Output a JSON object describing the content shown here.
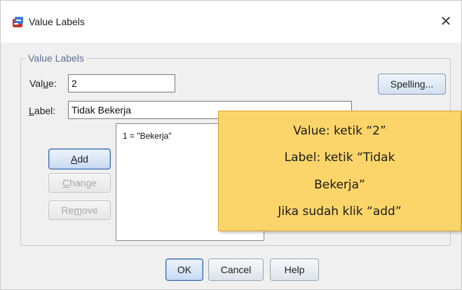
{
  "window": {
    "title": "Value Labels",
    "close_glyph": "✕"
  },
  "group": {
    "legend": "Value Labels"
  },
  "value_field": {
    "label_pre": "Val",
    "label_key": "u",
    "label_post": "e:",
    "value": "2"
  },
  "label_field": {
    "label_key": "L",
    "label_post": "abel:",
    "value": "Tidak Bekerja"
  },
  "buttons": {
    "spelling": "Spelling...",
    "add_key": "A",
    "add_post": "dd",
    "change_key": "C",
    "change_post": "hange",
    "remove_pre": "Re",
    "remove_key": "m",
    "remove_post": "ove",
    "ok": "OK",
    "cancel": "Cancel",
    "help": "Help"
  },
  "list": {
    "items": [
      "1 = \"Bekerja\""
    ]
  },
  "callout": {
    "lines": [
      "Value: ketik “2”",
      "Label: ketik “Tidak",
      "Bekerja”",
      "Jika sudah klik “add”"
    ]
  },
  "colors": {
    "callout_bg": "#fcd56a",
    "legend_text": "#5b6f9a",
    "primary_border": "#3b6aa8"
  }
}
